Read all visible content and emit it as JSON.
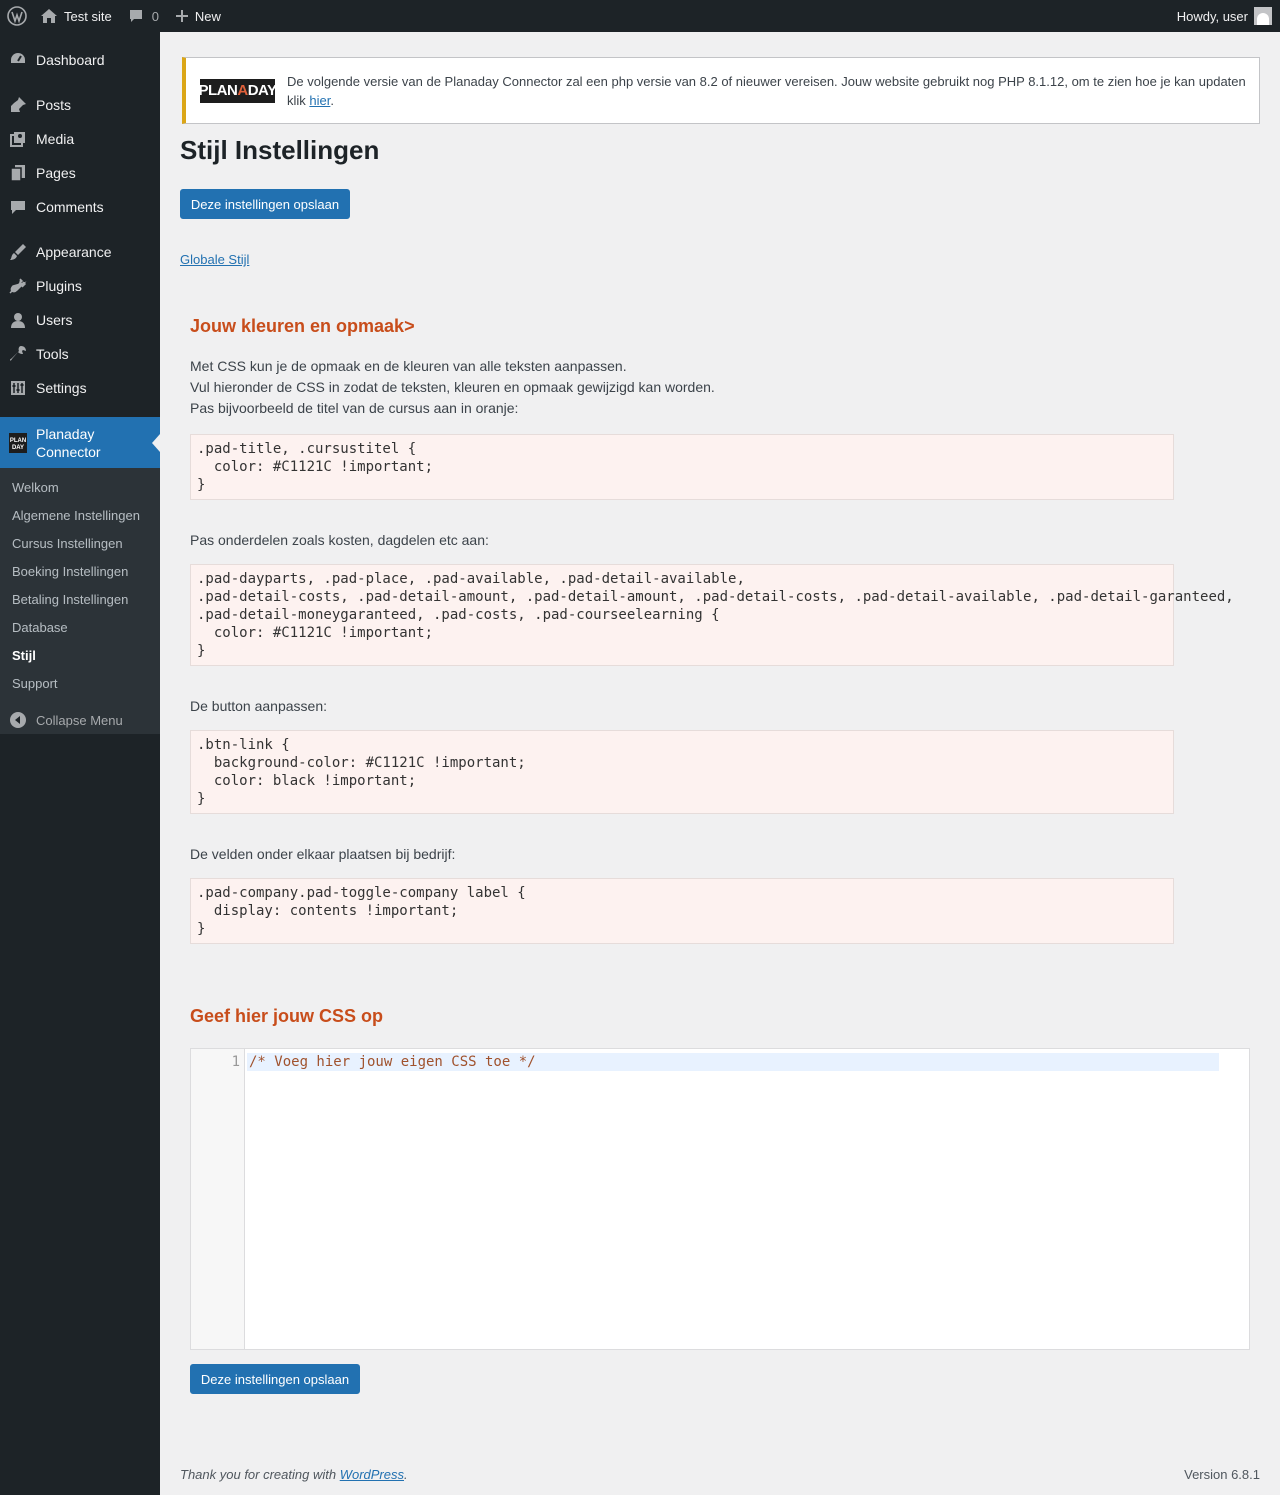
{
  "adminbar": {
    "site_name": "Test site",
    "comments_count": "0",
    "new_label": "New",
    "howdy": "Howdy, user"
  },
  "sidebar": {
    "items": [
      {
        "label": "Dashboard",
        "icon": "dashboard-icon"
      },
      {
        "label": "Posts",
        "icon": "pushpin-icon"
      },
      {
        "label": "Media",
        "icon": "media-icon"
      },
      {
        "label": "Pages",
        "icon": "pages-icon"
      },
      {
        "label": "Comments",
        "icon": "comment-icon"
      },
      {
        "label": "Appearance",
        "icon": "paintbrush-icon"
      },
      {
        "label": "Plugins",
        "icon": "plugin-icon"
      },
      {
        "label": "Users",
        "icon": "user-icon"
      },
      {
        "label": "Tools",
        "icon": "wrench-icon"
      },
      {
        "label": "Settings",
        "icon": "settings-icon"
      },
      {
        "label": "Planaday Connector",
        "icon": "planaday-icon"
      }
    ],
    "submenu": [
      "Welkom",
      "Algemene Instellingen",
      "Cursus Instellingen",
      "Boeking Instellingen",
      "Betaling Instellingen",
      "Database",
      "Stijl",
      "Support"
    ],
    "current_submenu": "Stijl",
    "collapse_label": "Collapse Menu"
  },
  "notice": {
    "logo_text_1": "PLAN",
    "logo_text_2": "A",
    "logo_text_3": "DAY",
    "text_before": "De volgende versie van de Planaday Connector zal een php versie van 8.2 of nieuwer vereisen. Jouw website gebruikt nog PHP 8.1.12, om te zien hoe je kan updaten klik ",
    "link": "hier",
    "text_after": "."
  },
  "page": {
    "title": "Stijl Instellingen",
    "save_button": "Deze instellingen opslaan",
    "global_link": "Globale Stijl"
  },
  "section1": {
    "title": "Jouw kleuren en opmaak>",
    "intro_1": "Met CSS kun je de opmaak en de kleuren van alle teksten aanpassen.",
    "intro_2": "Vul hieronder de CSS in zodat de teksten, kleuren en opmaak gewijzigd kan worden.",
    "intro_3": "Pas bijvoorbeeld de titel van de cursus aan in oranje:",
    "code_1": ".pad-title, .cursustitel {\n  color: #C1121C !important;\n}",
    "label_2": "Pas onderdelen zoals kosten, dagdelen etc aan:",
    "code_2": ".pad-dayparts, .pad-place, .pad-available, .pad-detail-available,\n.pad-detail-costs, .pad-detail-amount, .pad-detail-amount, .pad-detail-costs, .pad-detail-available, .pad-detail-garanteed,\n.pad-detail-moneygaranteed, .pad-costs, .pad-courseelearning {\n  color: #C1121C !important;\n}",
    "label_3": "De button aanpassen:",
    "code_3": ".btn-link {\n  background-color: #C1121C !important;\n  color: black !important;\n}",
    "label_4": "De velden onder elkaar plaatsen bij bedrijf:",
    "code_4": ".pad-company.pad-toggle-company label {\n  display: contents !important;\n}"
  },
  "section2": {
    "title": "Geef hier jouw CSS op",
    "line_number": "1",
    "editor_content": "/* Voeg hier jouw eigen CSS toe */"
  },
  "footer": {
    "thanks_before": "Thank you for creating with ",
    "thanks_link": "WordPress",
    "thanks_after": ".",
    "version": "Version 6.8.1"
  },
  "colors": {
    "admin_dark": "#1d2327",
    "accent": "#2271b1",
    "notice_warning": "#dba617",
    "section_title": "#c84d1b",
    "code_bg": "#fdf2f0"
  }
}
